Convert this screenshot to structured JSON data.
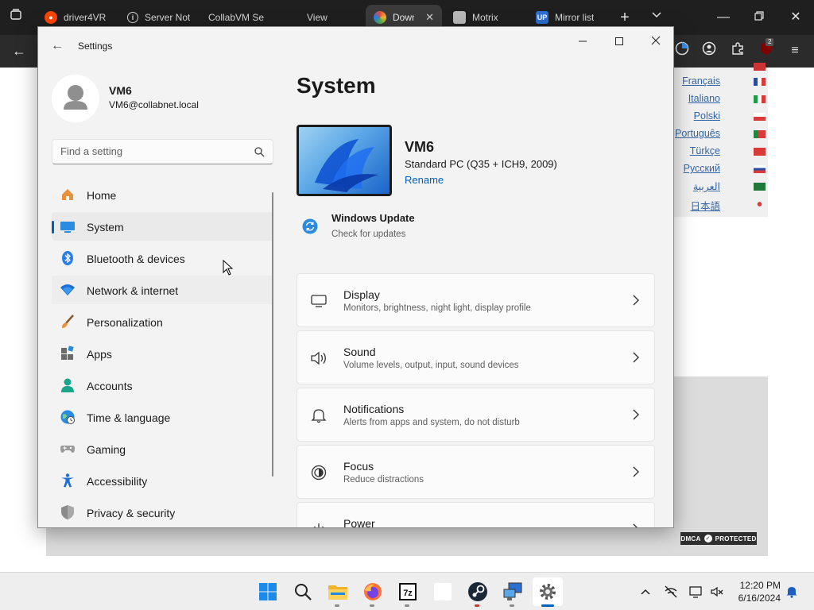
{
  "browser": {
    "tabs": [
      {
        "label": "driver4VR",
        "active": false
      },
      {
        "label": "Server Not",
        "active": false
      },
      {
        "label": "CollabVM Sea",
        "active": false
      },
      {
        "label": "View",
        "active": false
      },
      {
        "label": "Downlo",
        "active": true
      },
      {
        "label": "Motrix",
        "active": false
      },
      {
        "label": "Mirror list",
        "active": false
      }
    ],
    "extension_badge": "2"
  },
  "webpage": {
    "languages": [
      "Français",
      "Italiano",
      "Polski",
      "Português",
      "Türkçe",
      "Русский",
      "العربية",
      "日本語"
    ],
    "dmca_label": "DMCA",
    "dmca_status": "PROTECTED"
  },
  "settings": {
    "app_title": "Settings",
    "profile": {
      "name": "VM6",
      "email": "VM6@collabnet.local"
    },
    "search_placeholder": "Find a setting",
    "nav": [
      {
        "label": "Home",
        "icon": "home-icon"
      },
      {
        "label": "System",
        "icon": "system-icon",
        "selected": true
      },
      {
        "label": "Bluetooth & devices",
        "icon": "bluetooth-icon"
      },
      {
        "label": "Network & internet",
        "icon": "wifi-icon"
      },
      {
        "label": "Personalization",
        "icon": "brush-icon"
      },
      {
        "label": "Apps",
        "icon": "apps-icon"
      },
      {
        "label": "Accounts",
        "icon": "account-icon"
      },
      {
        "label": "Time & language",
        "icon": "globe-icon"
      },
      {
        "label": "Gaming",
        "icon": "gamepad-icon"
      },
      {
        "label": "Accessibility",
        "icon": "accessibility-icon"
      },
      {
        "label": "Privacy & security",
        "icon": "shield-icon"
      }
    ],
    "page_title": "System",
    "device": {
      "name": "VM6",
      "model": "Standard PC (Q35 + ICH9, 2009)",
      "rename_label": "Rename"
    },
    "windows_update": {
      "title": "Windows Update",
      "subtitle": "Check for updates"
    },
    "cards": [
      {
        "title": "Display",
        "subtitle": "Monitors, brightness, night light, display profile",
        "icon": "display-icon"
      },
      {
        "title": "Sound",
        "subtitle": "Volume levels, output, input, sound devices",
        "icon": "speaker-icon"
      },
      {
        "title": "Notifications",
        "subtitle": "Alerts from apps and system, do not disturb",
        "icon": "bell-icon"
      },
      {
        "title": "Focus",
        "subtitle": "Reduce distractions",
        "icon": "focus-icon"
      },
      {
        "title": "Power",
        "subtitle": "",
        "icon": "power-icon"
      }
    ]
  },
  "taskbar": {
    "time": "12:20 PM",
    "date": "6/16/2024",
    "accent_color": "#005fb8"
  }
}
